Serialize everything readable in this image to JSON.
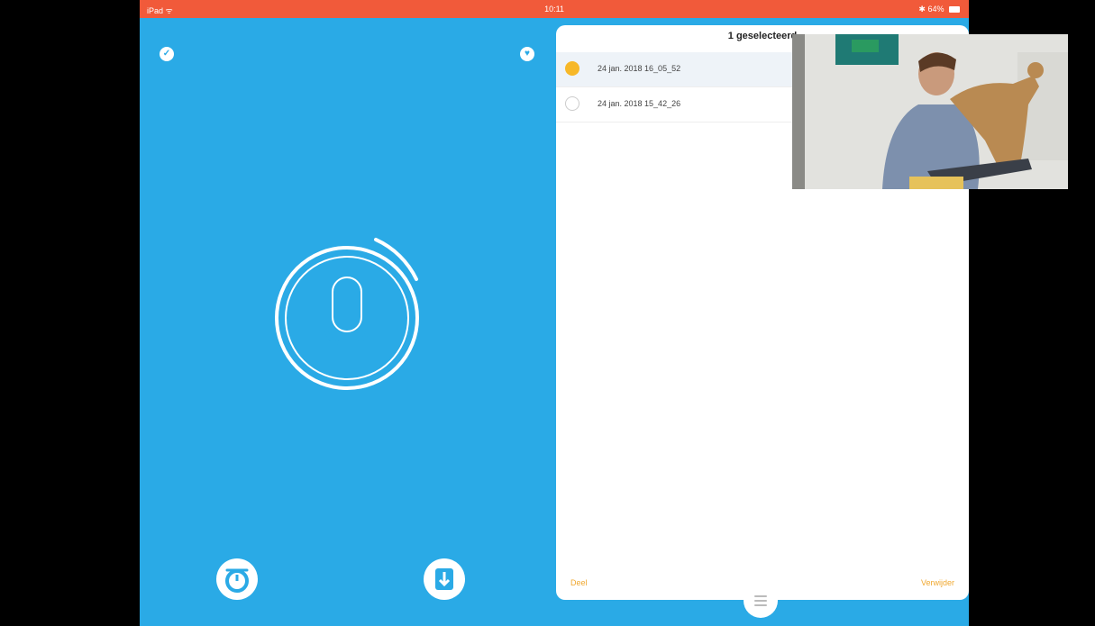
{
  "status_bar": {
    "left": "iPad ᯤ",
    "time": "10:11",
    "right": "✱ 64%"
  },
  "left_panel": {
    "top_left_icon": "check-circle-icon",
    "top_right_icon": "heart-circle-icon",
    "record_icon": "microphone-icon",
    "bottom_left_icon": "timer-icon",
    "bottom_right_icon": "import-icon"
  },
  "right_panel": {
    "title": "1 geselecteerd",
    "recordings": [
      {
        "label": "24 jan. 2018 16_05_52",
        "selected": true
      },
      {
        "label": "24 jan. 2018 15_42_26",
        "selected": false
      }
    ],
    "footer_left": "Deel",
    "footer_right": "Verwijder"
  },
  "colors": {
    "accent_blue": "#2aaae6",
    "status_red": "#f15a3a",
    "select_yellow": "#f7b828"
  }
}
